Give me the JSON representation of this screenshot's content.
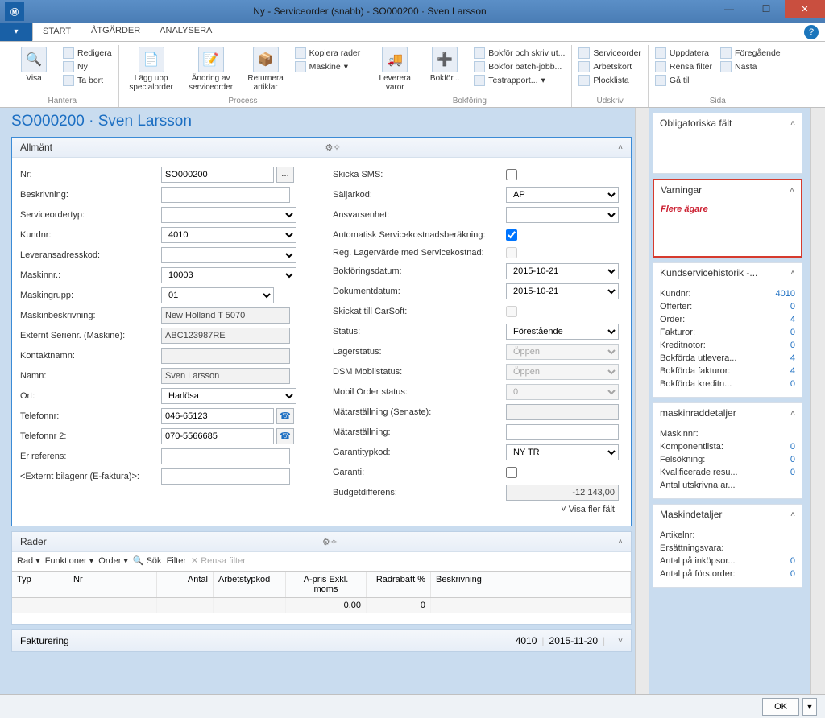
{
  "window": {
    "title": "Ny - Serviceorder (snabb) - SO000200 · Sven Larsson"
  },
  "tabs": {
    "file": "▾",
    "start": "START",
    "atgarder": "ÅTGÄRDER",
    "analysera": "ANALYSERA"
  },
  "ribbon": {
    "hantera": {
      "label": "Hantera",
      "visa": "Visa",
      "redigera": "Redigera",
      "ny": "Ny",
      "tabort": "Ta bort"
    },
    "process": {
      "label": "Process",
      "lagg": "Lägg upp\nspecialorder",
      "andring": "Ändring av\nserviceorder",
      "returnera": "Returnera\nartiklar",
      "kopiera": "Kopiera rader",
      "maskine": "Maskine"
    },
    "bokforing": {
      "label": "Bokföring",
      "leverera": "Leverera\nvaror",
      "bokfor": "Bokför...",
      "bokskriv": "Bokför och skriv ut...",
      "bokbatch": "Bokför batch-jobb...",
      "testrapp": "Testrapport..."
    },
    "udskriv": {
      "label": "Udskriv",
      "serviceorder": "Serviceorder",
      "arbetskort": "Arbetskort",
      "plocklista": "Plocklista"
    },
    "sida": {
      "label": "Sida",
      "uppdatera": "Uppdatera",
      "rensa": "Rensa filter",
      "gatill": "Gå till",
      "foreg": "Föregående",
      "nasta": "Nästa"
    }
  },
  "page_title": "SO000200 · Sven Larsson",
  "allmant": {
    "title": "Allmänt",
    "fields_left": {
      "nr": {
        "label": "Nr:",
        "value": "SO000200"
      },
      "beskrivning": {
        "label": "Beskrivning:",
        "value": ""
      },
      "serviceordertyp": {
        "label": "Serviceordertyp:",
        "value": ""
      },
      "kundnr": {
        "label": "Kundnr:",
        "value": "4010"
      },
      "leveransadresskod": {
        "label": "Leveransadresskod:",
        "value": ""
      },
      "maskinnr": {
        "label": "Maskinnr.:",
        "value": "10003"
      },
      "maskingrupp": {
        "label": "Maskingrupp:",
        "value": "01"
      },
      "maskinbeskrivning": {
        "label": "Maskinbeskrivning:",
        "value": "New Holland T 5070"
      },
      "externt_serienr": {
        "label": "Externt Serienr. (Maskine):",
        "value": "ABC123987RE"
      },
      "kontaktnamn": {
        "label": "Kontaktnamn:",
        "value": ""
      },
      "namn": {
        "label": "Namn:",
        "value": "Sven Larsson"
      },
      "ort": {
        "label": "Ort:",
        "value": "Harlösa"
      },
      "telefonnr": {
        "label": "Telefonnr:",
        "value": "046-65123"
      },
      "telefonnr2": {
        "label": "Telefonnr 2:",
        "value": "070-5566685"
      },
      "er_referens": {
        "label": "Er referens:",
        "value": ""
      },
      "externt_bilagenr": {
        "label": "<Externt bilagenr (E-faktura)>:",
        "value": ""
      }
    },
    "fields_right": {
      "skicka_sms": {
        "label": "Skicka SMS:",
        "checked": false
      },
      "saljarkod": {
        "label": "Säljarkod:",
        "value": "AP"
      },
      "ansvarsenhet": {
        "label": "Ansvarsenhet:",
        "value": ""
      },
      "auto_servicekostnad": {
        "label": "Automatisk Servicekostnadsberäkning:",
        "checked": true
      },
      "reg_lagervarde": {
        "label": "Reg. Lagervärde med Servicekostnad:",
        "checked": false
      },
      "bokforingsdatum": {
        "label": "Bokföringsdatum:",
        "value": "2015-10-21"
      },
      "dokumentdatum": {
        "label": "Dokumentdatum:",
        "value": "2015-10-21"
      },
      "skickat_carsoft": {
        "label": "Skickat till CarSoft:",
        "checked": false
      },
      "status": {
        "label": "Status:",
        "value": "Förestående"
      },
      "lagerstatus": {
        "label": "Lagerstatus:",
        "value": "Öppen"
      },
      "dsm_mobilstatus": {
        "label": "DSM Mobilstatus:",
        "value": "Öppen"
      },
      "mobil_order_status": {
        "label": "Mobil Order status:",
        "value": "0"
      },
      "matarstallning_senaste": {
        "label": "Mätarställning (Senaste):",
        "value": ""
      },
      "matarstallning": {
        "label": "Mätarställning:",
        "value": ""
      },
      "garantitypkod": {
        "label": "Garantitypkod:",
        "value": "NY TR"
      },
      "garanti": {
        "label": "Garanti:",
        "checked": false
      },
      "budgetdifferens": {
        "label": "Budgetdifferens:",
        "value": "-12 143,00"
      }
    },
    "show_more": "Visa fler fält"
  },
  "rader": {
    "title": "Rader",
    "toolbar": {
      "rad": "Rad",
      "funktioner": "Funktioner",
      "order": "Order",
      "sok": "Sök",
      "filter": "Filter",
      "rensa": "Rensa filter"
    },
    "columns": {
      "typ": "Typ",
      "nr": "Nr",
      "antal": "Antal",
      "arbetstypkod": "Arbetstypkod",
      "apris": "A-pris Exkl. moms",
      "radrabatt": "Radrabatt %",
      "beskrivning": "Beskrivning"
    },
    "rows": [
      {
        "typ": "",
        "nr": "",
        "antal": "",
        "arbetstypkod": "",
        "apris": "0,00",
        "radrabatt": "0",
        "beskrivning": ""
      }
    ]
  },
  "fakturering": {
    "title": "Fakturering",
    "kund": "4010",
    "datum": "2015-11-20"
  },
  "side": {
    "obligatoriska": {
      "title": "Obligatoriska fält"
    },
    "varningar": {
      "title": "Varningar",
      "text": "Flere ägare"
    },
    "kundservice": {
      "title": "Kundservicehistorik -...",
      "rows": [
        {
          "l": "Kundnr:",
          "v": "4010"
        },
        {
          "l": "Offerter:",
          "v": "0"
        },
        {
          "l": "Order:",
          "v": "4"
        },
        {
          "l": "Fakturor:",
          "v": "0"
        },
        {
          "l": "Kreditnotor:",
          "v": "0"
        },
        {
          "l": "Bokförda utlevera...",
          "v": "4"
        },
        {
          "l": "Bokförda fakturor:",
          "v": "4"
        },
        {
          "l": "Bokförda kreditn...",
          "v": "0"
        }
      ]
    },
    "maskinrad": {
      "title": "maskinraddetaljer",
      "rows": [
        {
          "l": "Maskinnr:",
          "v": ""
        },
        {
          "l": "Komponentlista:",
          "v": "0"
        },
        {
          "l": "Felsökning:",
          "v": "0"
        },
        {
          "l": "Kvalificerade resu...",
          "v": "0"
        },
        {
          "l": "Antal utskrivna ar...",
          "v": ""
        }
      ]
    },
    "maskindetaljer": {
      "title": "Maskindetaljer",
      "rows": [
        {
          "l": "Artikelnr:",
          "v": ""
        },
        {
          "l": "Ersättningsvara:",
          "v": ""
        },
        {
          "l": "Antal på inköpsor...",
          "v": "0"
        },
        {
          "l": "Antal på förs.order:",
          "v": "0"
        }
      ]
    }
  },
  "okbar": {
    "ok": "OK"
  }
}
